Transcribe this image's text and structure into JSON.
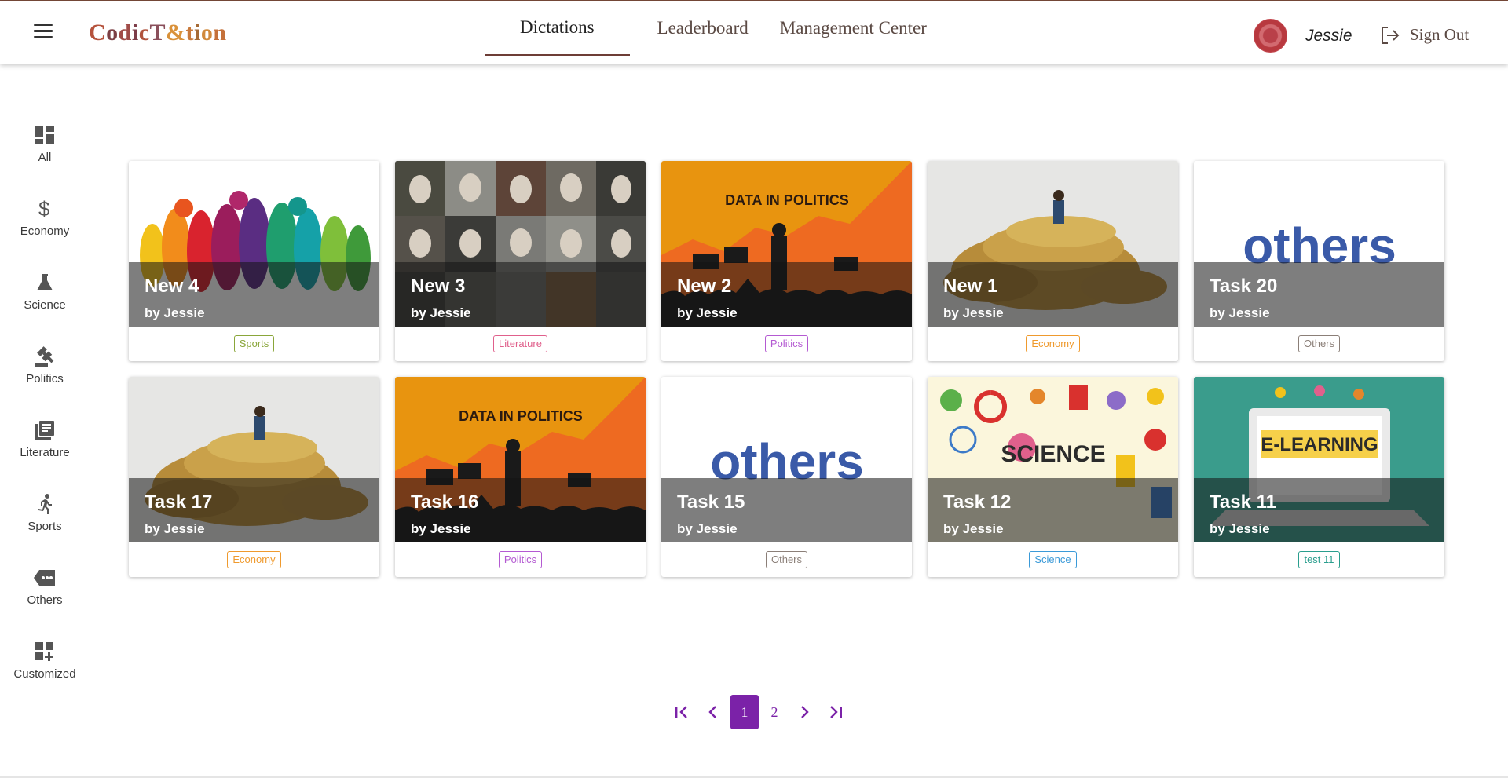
{
  "app": {
    "logo_text": "CodicTation"
  },
  "nav": {
    "tabs": [
      {
        "label": "Dictations",
        "active": true
      },
      {
        "label": "Leaderboard",
        "active": false
      },
      {
        "label": "Management Center",
        "active": false
      }
    ]
  },
  "user": {
    "name": "Jessie",
    "signout_label": "Sign Out"
  },
  "sidebar": {
    "items": [
      {
        "label": "All",
        "icon": "dashboard-icon"
      },
      {
        "label": "Economy",
        "icon": "dollar-icon"
      },
      {
        "label": "Science",
        "icon": "flask-icon"
      },
      {
        "label": "Politics",
        "icon": "gavel-icon"
      },
      {
        "label": "Literature",
        "icon": "book-icon"
      },
      {
        "label": "Sports",
        "icon": "runner-icon"
      },
      {
        "label": "Others",
        "icon": "more-tag-icon"
      },
      {
        "label": "Customized",
        "icon": "add-grid-icon"
      }
    ]
  },
  "cards": [
    {
      "title": "New 4",
      "author": "by Jessie",
      "tag": "Sports",
      "tag_color": "#8aa63a",
      "image": "sports-silhouettes"
    },
    {
      "title": "New 3",
      "author": "by Jessie",
      "tag": "Literature",
      "tag_color": "#e0608c",
      "image": "literature-portraits"
    },
    {
      "title": "New 2",
      "author": "by Jessie",
      "tag": "Politics",
      "tag_color": "#b45ad2",
      "image": "data-in-politics"
    },
    {
      "title": "New 1",
      "author": "by Jessie",
      "tag": "Economy",
      "tag_color": "#ef9a2e",
      "image": "coins-reader"
    },
    {
      "title": "Task 20",
      "author": "by Jessie",
      "tag": "Others",
      "tag_color": "#8b7f78",
      "image": "others-lettering"
    },
    {
      "title": "Task 17",
      "author": "by Jessie",
      "tag": "Economy",
      "tag_color": "#ef9a2e",
      "image": "coins-reader"
    },
    {
      "title": "Task 16",
      "author": "by Jessie",
      "tag": "Politics",
      "tag_color": "#b45ad2",
      "image": "data-in-politics"
    },
    {
      "title": "Task 15",
      "author": "by Jessie",
      "tag": "Others",
      "tag_color": "#8b7f78",
      "image": "others-lettering"
    },
    {
      "title": "Task 12",
      "author": "by Jessie",
      "tag": "Science",
      "tag_color": "#3b9ad8",
      "image": "science-doodles"
    },
    {
      "title": "Task 11",
      "author": "by Jessie",
      "tag": "test 11",
      "tag_color": "#2a9e8e",
      "image": "e-learning"
    }
  ],
  "images": {
    "politics_banner": "DATA IN POLITICS",
    "others_word": "others",
    "science_word": "SCIENCE",
    "elearning_word": "E-LEARNING"
  },
  "pagination": {
    "pages": [
      "1",
      "2"
    ],
    "current": "1"
  },
  "colors": {
    "accent": "#7b22a8",
    "header_brown": "#6d3d36"
  }
}
